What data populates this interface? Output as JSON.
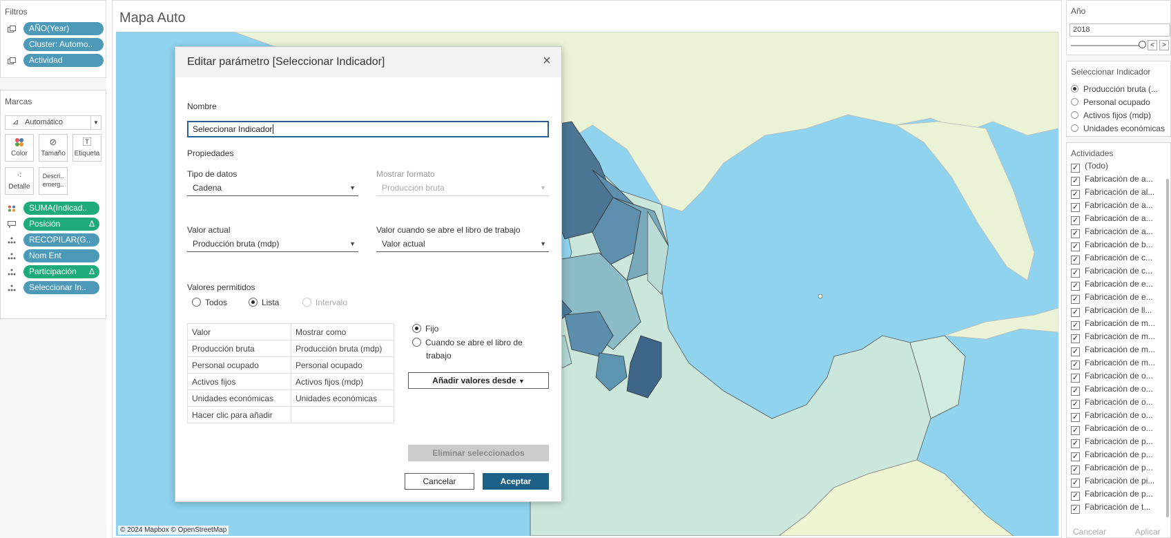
{
  "filters": {
    "title": "Filtros",
    "items": [
      "AÑO(Year)",
      "Cluster: Automo..",
      "Actividad"
    ]
  },
  "marks": {
    "title": "Marcas",
    "type": "Automático",
    "buttons": [
      "Color",
      "Tamaño",
      "Etiqueta",
      "Detalle",
      "Descri.. emerg.."
    ],
    "pills": [
      {
        "label": "SUMA(Indicad..",
        "color": "green"
      },
      {
        "label": "Posición",
        "color": "green",
        "delta": "Δ"
      },
      {
        "label": "RECOPILAR(G..",
        "color": "blue"
      },
      {
        "label": "Nom Ent",
        "color": "blue"
      },
      {
        "label": "Participación",
        "color": "green",
        "delta": "Δ"
      },
      {
        "label": "Seleccionar In..",
        "color": "blue"
      }
    ]
  },
  "viz": {
    "title": "Mapa Auto",
    "attribution": "© 2024 Mapbox © OpenStreetMap"
  },
  "year_filter": {
    "title": "Año",
    "value": "2018",
    "prev": "<",
    "next": ">"
  },
  "indicator_param": {
    "title": "Seleccionar Indicador",
    "options": [
      "Producción bruta (...",
      "Personal ocupado",
      "Activos fijos (mdp)",
      "Unidades económicas"
    ],
    "selected_index": 0
  },
  "activities": {
    "title": "Actividades",
    "items": [
      "(Todo)",
      "Fabricación de a...",
      "Fabricación de al...",
      "Fabricación de a...",
      "Fabricación de a...",
      "Fabricación de a...",
      "Fabricación de b...",
      "Fabricación de c...",
      "Fabricación de c...",
      "Fabricación de e...",
      "Fabricación de e...",
      "Fabricación de ll...",
      "Fabricación de m...",
      "Fabricación de m...",
      "Fabricación de m...",
      "Fabricación de m...",
      "Fabricación de o...",
      "Fabricación de o...",
      "Fabricación de o...",
      "Fabricación de o...",
      "Fabricación de o...",
      "Fabricación de p...",
      "Fabricación de p...",
      "Fabricación de p...",
      "Fabricación de pi...",
      "Fabricación de p...",
      "Fabricación de t..."
    ],
    "cancel": "Cancelar",
    "apply": "Aplicar"
  },
  "dialog": {
    "title": "Editar parámetro [Seleccionar Indicador]",
    "close": "×",
    "name_label": "Nombre",
    "name_value": "Seleccionar Indicador",
    "properties_label": "Propiedades",
    "data_type_label": "Tipo de datos",
    "data_type_value": "Cadena",
    "display_format_label": "Mostrar formato",
    "display_format_value": "Producción bruta",
    "current_value_label": "Valor actual",
    "current_value": "Producción bruta (mdp)",
    "open_value_label": "Valor cuando se abre el libro de trabajo",
    "open_value": "Valor actual",
    "allowed_label": "Valores permitidos",
    "allowed_options": [
      "Todos",
      "Lista",
      "Intervalo"
    ],
    "allowed_selected": "Lista",
    "table_headers": [
      "Valor",
      "Mostrar como"
    ],
    "table_rows": [
      [
        "Producción bruta",
        "Producción bruta (mdp)"
      ],
      [
        "Personal ocupado",
        "Personal ocupado"
      ],
      [
        "Activos fijos",
        "Activos fijos (mdp)"
      ],
      [
        "Unidades económicas",
        "Unidades económicas"
      ],
      [
        "Hacer clic para añadir",
        ""
      ]
    ],
    "fixed_label": "Fijo",
    "when_open_label_1": "Cuando se abre el libro de",
    "when_open_label_2": "trabajo",
    "add_values_button": "Añadir valores desde",
    "remove_button": "Eliminar seleccionados",
    "cancel_button": "Cancelar",
    "ok_button": "Aceptar"
  },
  "colors": {
    "accent": "#1c5f87",
    "pill_blue": "#4d99b8",
    "pill_green": "#1faa7a",
    "water": "#8fd3ef",
    "land": "#eaf3d6"
  }
}
